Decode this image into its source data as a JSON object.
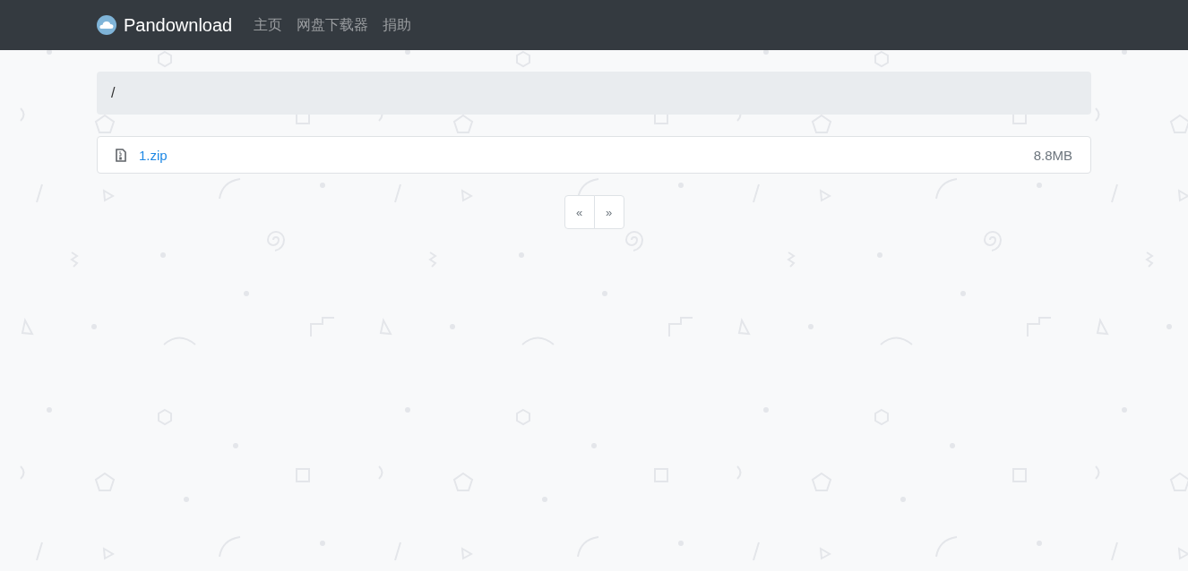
{
  "navbar": {
    "brand": "Pandownload",
    "links": [
      {
        "label": "主页"
      },
      {
        "label": "网盘下载器"
      },
      {
        "label": "捐助"
      }
    ]
  },
  "breadcrumb": {
    "path": "/"
  },
  "files": [
    {
      "name": "1.zip",
      "size": "8.8MB"
    }
  ],
  "pagination": [
    {
      "label": "«"
    },
    {
      "label": "»"
    }
  ]
}
